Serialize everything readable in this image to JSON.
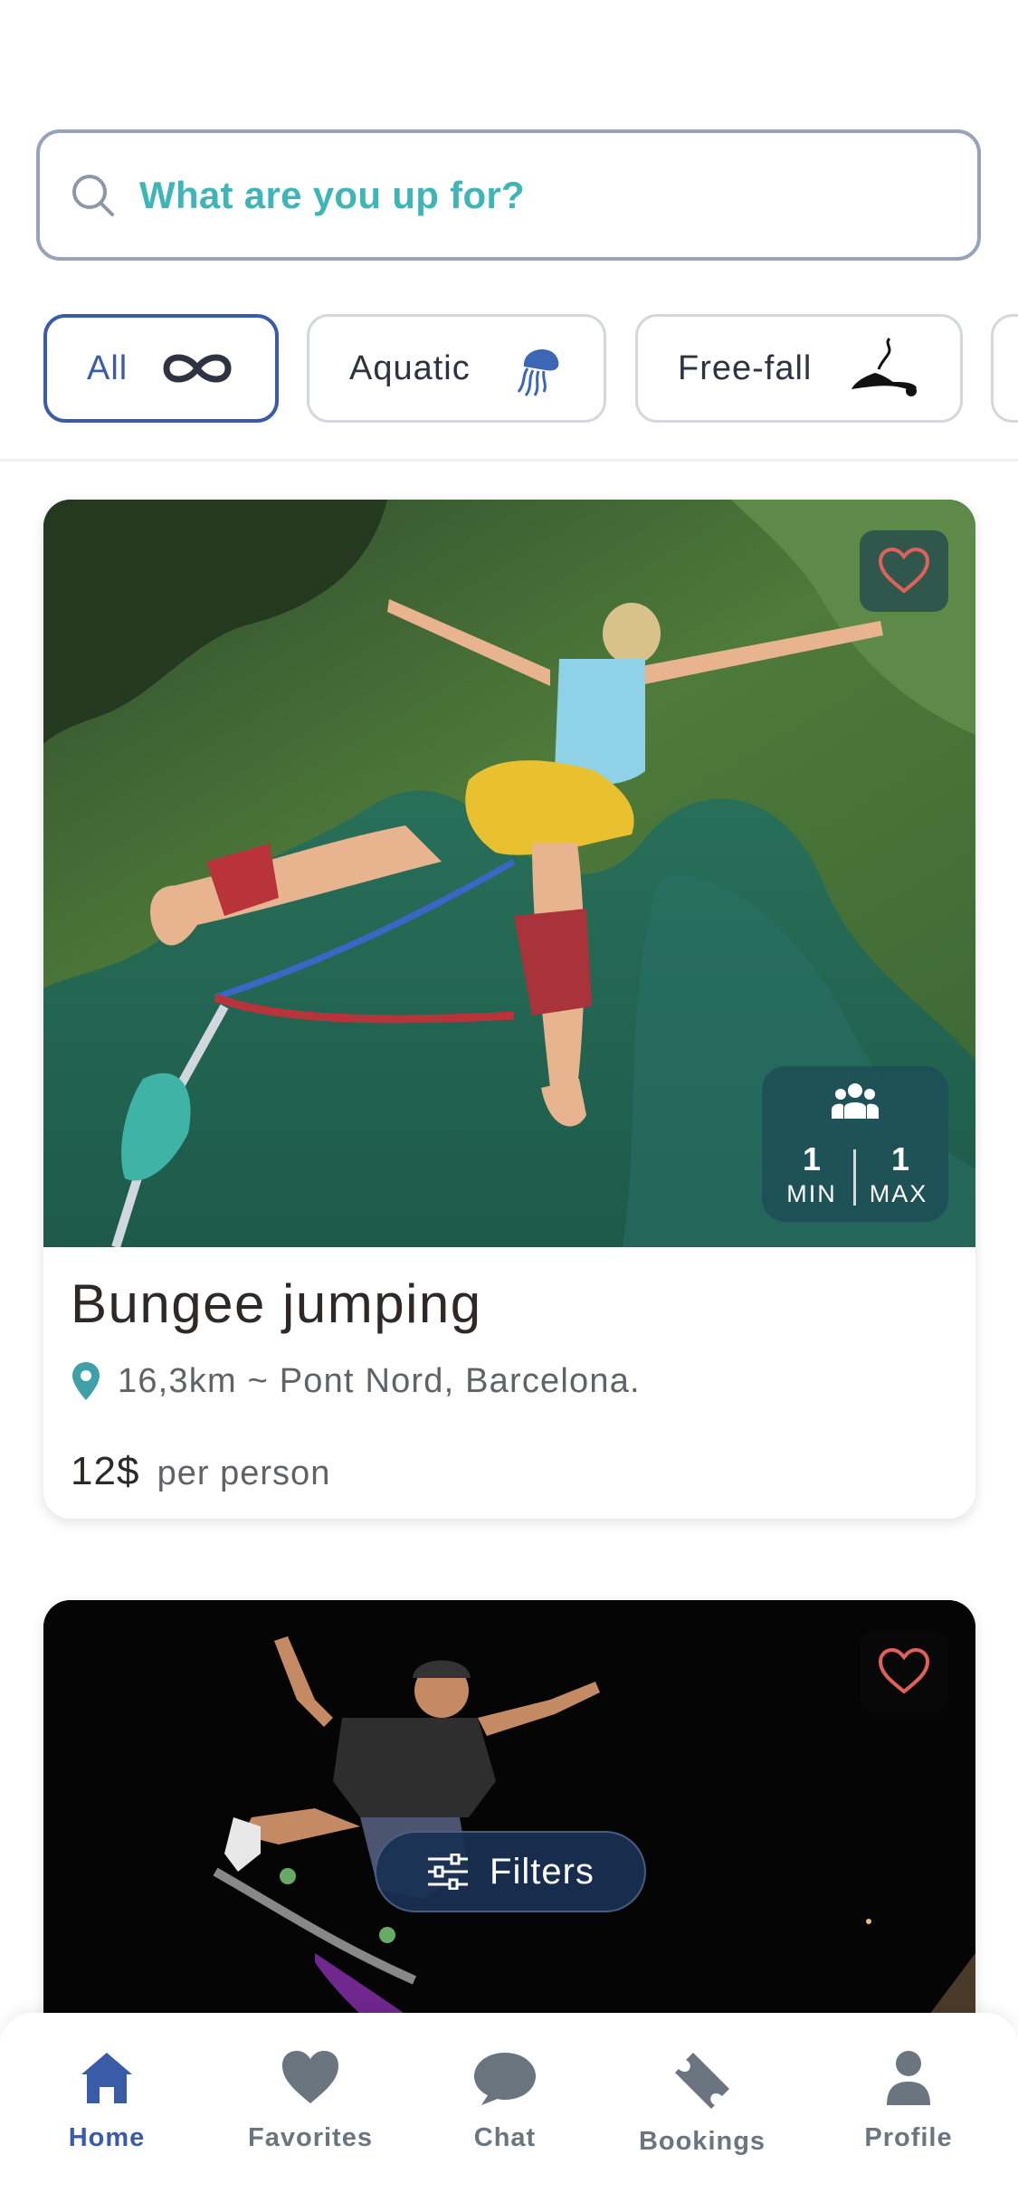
{
  "search": {
    "placeholder": "What are you up for?"
  },
  "categories": [
    {
      "label": "All",
      "icon": "infinity-icon",
      "active": true
    },
    {
      "label": "Aquatic",
      "icon": "jellyfish-icon",
      "active": false
    },
    {
      "label": "Free-fall",
      "icon": "bungee-jumper-icon",
      "active": false
    }
  ],
  "cards": [
    {
      "title": "Bungee jumping",
      "location": "16,3km ~ Pont Nord, Barcelona.",
      "price": "12$",
      "price_unit": "per person",
      "capacity": {
        "min": "1",
        "min_label": "MIN",
        "max": "1",
        "max_label": "MAX"
      }
    },
    {
      "title": "",
      "image": "skateboarder"
    }
  ],
  "filters": {
    "label": "Filters"
  },
  "nav": [
    {
      "label": "Home",
      "icon": "home-icon",
      "active": true
    },
    {
      "label": "Favorites",
      "icon": "heart-icon",
      "active": false
    },
    {
      "label": "Chat",
      "icon": "chat-bubble-icon",
      "active": false
    },
    {
      "label": "Bookings",
      "icon": "ticket-icon",
      "active": false
    },
    {
      "label": "Profile",
      "icon": "person-icon",
      "active": false
    }
  ],
  "colors": {
    "accent": "#3a5ba8",
    "teal": "#3fb5b8",
    "heart": "#e0605c",
    "nav_inactive": "#6b7580"
  }
}
